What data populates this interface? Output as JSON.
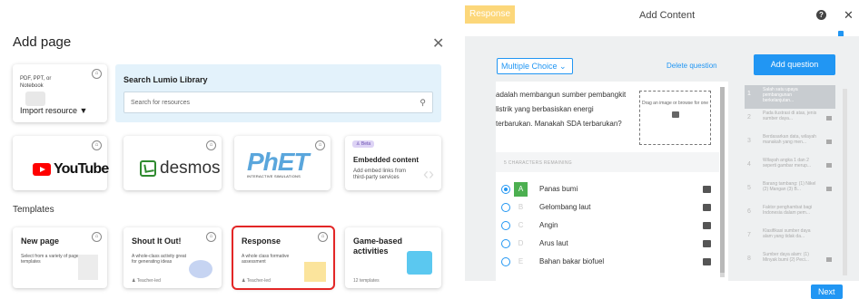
{
  "add_page": {
    "title": "Add page",
    "import": {
      "small": "PDF, PPT, or Notebook",
      "label": "Import resource ▼"
    },
    "search": {
      "title": "Search Lumio Library",
      "placeholder": "Search for resources"
    },
    "apps": {
      "youtube": "YouTube",
      "desmos": "desmos",
      "phet_logo": "PhET",
      "phet_sub": "INTERACTIVE SIMULATIONS",
      "embedded": {
        "beta": "Beta",
        "title": "Embedded content",
        "desc": "Add embed links from third-party services"
      }
    },
    "templates_label": "Templates",
    "templates": [
      {
        "title": "New page",
        "desc": "Select from a variety of page templates",
        "meta": ""
      },
      {
        "title": "Shout It Out!",
        "desc": "A whole-class activity great for generating ideas",
        "meta": "Teacher-led"
      },
      {
        "title": "Response",
        "desc": "A whole class formative assessment",
        "meta": "Teacher-led"
      },
      {
        "title": "Game-based activities",
        "desc": "",
        "meta": "12 templates"
      }
    ]
  },
  "content": {
    "tab": "Response",
    "title": "Add Content",
    "question_type": "Multiple Choice",
    "delete_label": "Delete question",
    "add_label": "Add question",
    "question_text": "adalah membangun sumber pembangkit listrik yang berbasiskan energi terbarukan. Manakah SDA terbarukan?",
    "drop_label": "Drag an image or browse for one",
    "chars_remaining": "5 CHARACTERS REMAINING",
    "options": [
      {
        "letter": "A",
        "text": "Panas bumi",
        "selected": true
      },
      {
        "letter": "B",
        "text": "Gelombang laut",
        "selected": false
      },
      {
        "letter": "C",
        "text": "Angin",
        "selected": false
      },
      {
        "letter": "D",
        "text": "Arus laut",
        "selected": false
      },
      {
        "letter": "E",
        "text": "Bahan bakar biofuel",
        "selected": false
      }
    ],
    "side_questions": [
      {
        "num": "1",
        "text": "Salah satu upaya pembangunan berkelanjutan..."
      },
      {
        "num": "2",
        "text": "Pada ilustrasi di atas, jenis sumber daya..."
      },
      {
        "num": "3",
        "text": "Berdasarkan data, wilayah manakah yang men..."
      },
      {
        "num": "4",
        "text": "Wilayah angka 1 dan 2 seperti gambar merup..."
      },
      {
        "num": "5",
        "text": "Barang tambang: (1) Nikel (2) Mangan (3) B..."
      },
      {
        "num": "6",
        "text": "Faktor penghambat bagi Indonesia dalam pem..."
      },
      {
        "num": "7",
        "text": "Klasifikasi sumber daya alam yang tidak da..."
      },
      {
        "num": "8",
        "text": "Sumber daya alam: (1) Minyak bumi (2) Peci..."
      }
    ],
    "next_label": "Next"
  }
}
